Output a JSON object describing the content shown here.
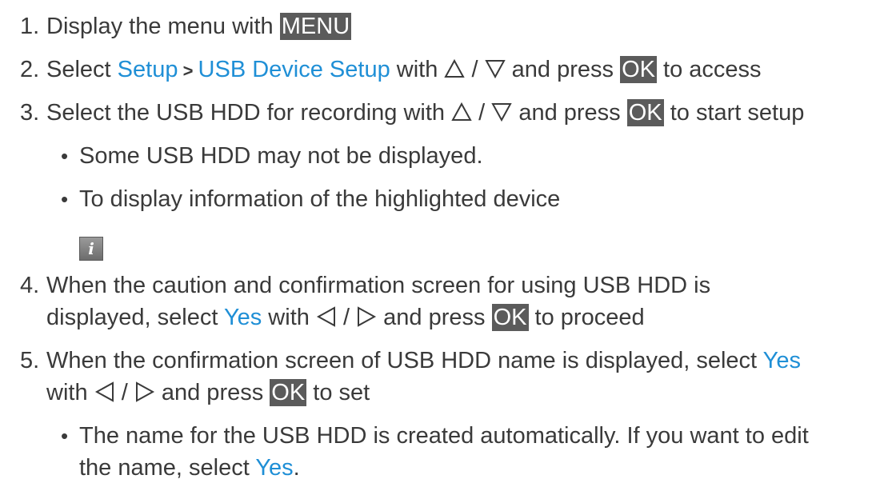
{
  "steps": [
    {
      "num": "1.",
      "text_a": "Display the menu with ",
      "key": "MENU"
    },
    {
      "num": "2.",
      "text_a": "Select ",
      "link_a": "Setup",
      "sep": " > ",
      "link_b": "USB Device Setup",
      "text_b": " with ",
      "slash": " / ",
      "text_c": " and press ",
      "key": "OK",
      "text_d": " to access"
    },
    {
      "num": "3.",
      "text_a": "Select the USB HDD for recording with ",
      "slash": " / ",
      "text_b": " and press ",
      "key": "OK",
      "text_c": " to start setup"
    },
    {
      "num": "4.",
      "line1": "When the caution and confirmation screen for using USB HDD is",
      "text_a": "displayed, select ",
      "link": "Yes",
      "text_b": " with ",
      "slash": " / ",
      "text_c": " and press ",
      "key": "OK",
      "text_d": " to proceed"
    },
    {
      "num": "5.",
      "text_a": "When the confirmation screen of USB HDD name is displayed, select ",
      "link": "Yes",
      "text_b": "with ",
      "slash": " / ",
      "text_c": " and press ",
      "key": "OK",
      "text_d": " to set"
    }
  ],
  "bullets": {
    "b1": "Some USB HDD may not be displayed.",
    "b2": "To display information of the highlighted device",
    "b3_line1": "The name for the USB HDD is created automatically. If you want to edit",
    "b3_line2_a": "the name, select ",
    "b3_link": "Yes",
    "b3_end": "."
  },
  "bullet_char": "•",
  "icons": {
    "up": "up-triangle-icon",
    "down": "down-triangle-icon",
    "left": "left-triangle-icon",
    "right": "right-triangle-icon",
    "info": "info-icon",
    "info_glyph": "i"
  },
  "colors": {
    "link": "#1f8fd6",
    "key_bg": "#5b5b5b",
    "text": "#3a3a3a"
  }
}
